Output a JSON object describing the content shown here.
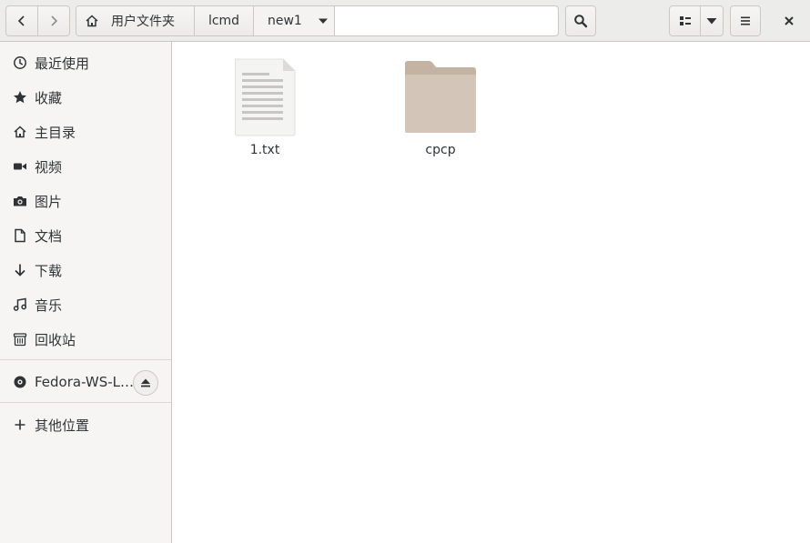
{
  "header": {
    "breadcrumbs": [
      {
        "label": "用户文件夹",
        "icon": "home-icon"
      },
      {
        "label": "lcmd"
      },
      {
        "label": "new1"
      }
    ]
  },
  "sidebar": {
    "places": [
      {
        "label": "最近使用",
        "icon": "recent-icon"
      },
      {
        "label": "收藏",
        "icon": "star-icon"
      },
      {
        "label": "主目录",
        "icon": "home-icon"
      },
      {
        "label": "视频",
        "icon": "video-icon"
      },
      {
        "label": "图片",
        "icon": "camera-icon"
      },
      {
        "label": "文档",
        "icon": "document-icon"
      },
      {
        "label": "下载",
        "icon": "download-icon"
      },
      {
        "label": "音乐",
        "icon": "music-icon"
      },
      {
        "label": "回收站",
        "icon": "trash-icon"
      }
    ],
    "device": {
      "label": "Fedora-WS-L…",
      "icon": "disc-icon"
    },
    "other": {
      "label": "其他位置",
      "icon": "plus-icon"
    }
  },
  "files": [
    {
      "name": "1.txt",
      "type": "text-file"
    },
    {
      "name": "cpcp",
      "type": "folder"
    }
  ],
  "colors": {
    "folder": "#d3c6b8",
    "folder_tab": "#c4b2a2",
    "headerbar": "#ececea",
    "sidebar": "#f6f5f4"
  }
}
